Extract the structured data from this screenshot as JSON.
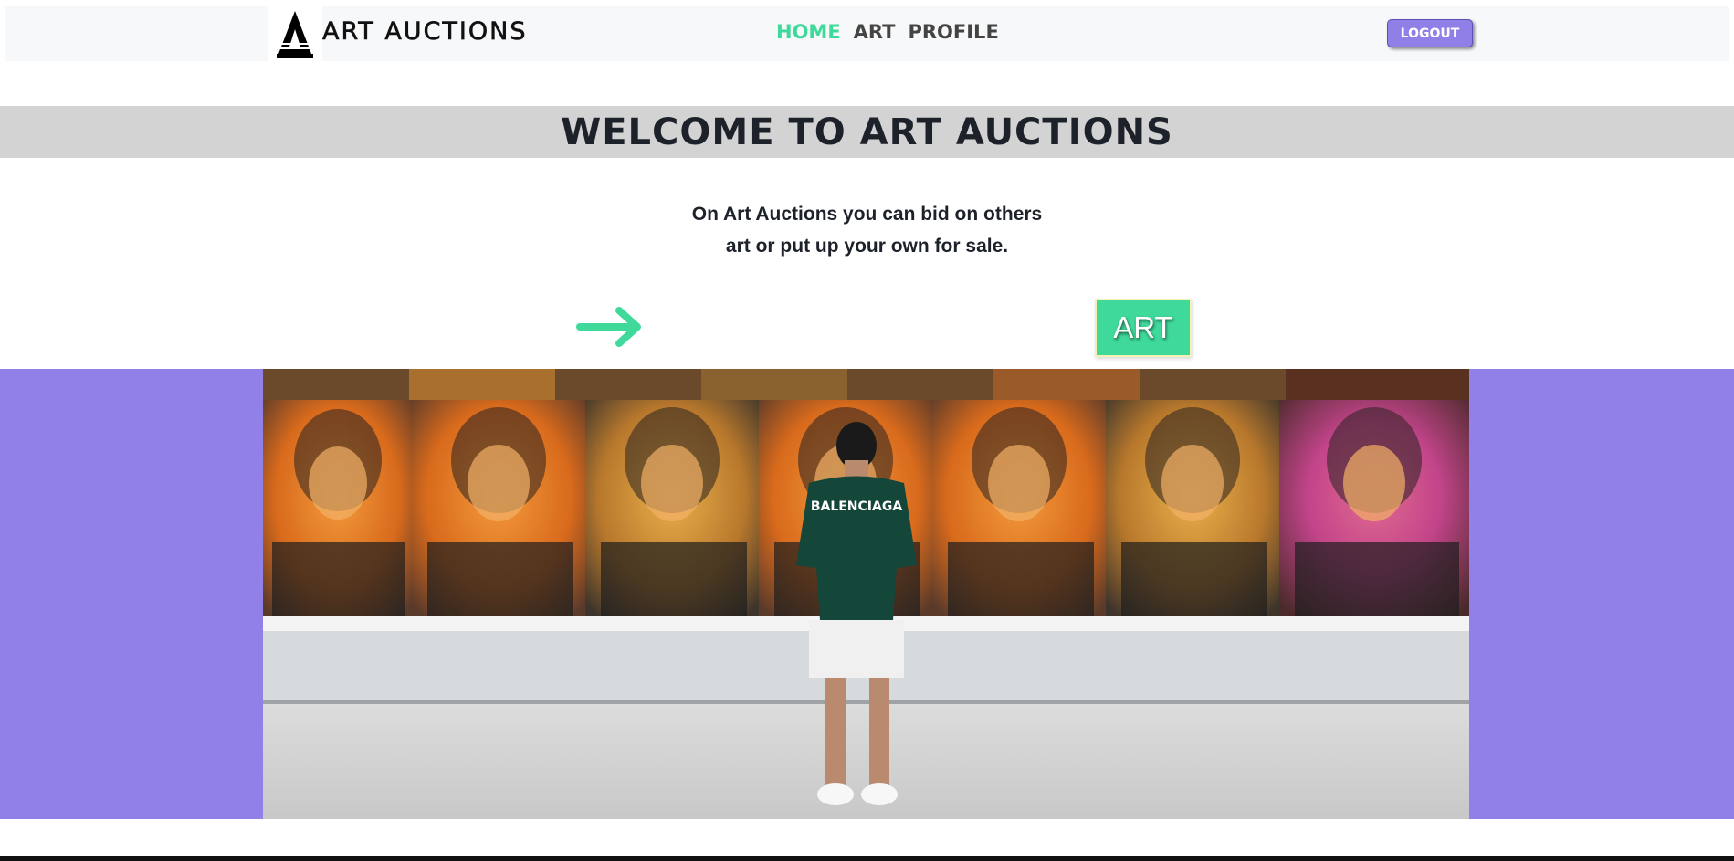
{
  "header": {
    "brand": "ART AUCTIONS",
    "nav": [
      {
        "label": "HOME",
        "active": true
      },
      {
        "label": "ART",
        "active": false
      },
      {
        "label": "PROFILE",
        "active": false
      }
    ],
    "logout_label": "LOGOUT"
  },
  "main": {
    "title": "WELCOME TO ART AUCTIONS",
    "intro_line1": "On Art Auctions you can bid on others",
    "intro_line2": "art or put up your own for sale.",
    "art_button_label": "ART",
    "arrow_icon": "arrow-right-icon"
  },
  "hero": {
    "shirt_text": "BALENCIAGA"
  },
  "colors": {
    "accent_green": "#3fd99b",
    "accent_purple": "#9080e8",
    "logout_purple": "#8f7fe7",
    "band_gray": "#d3d3d3",
    "navbar_bg": "#f7f8f9"
  }
}
